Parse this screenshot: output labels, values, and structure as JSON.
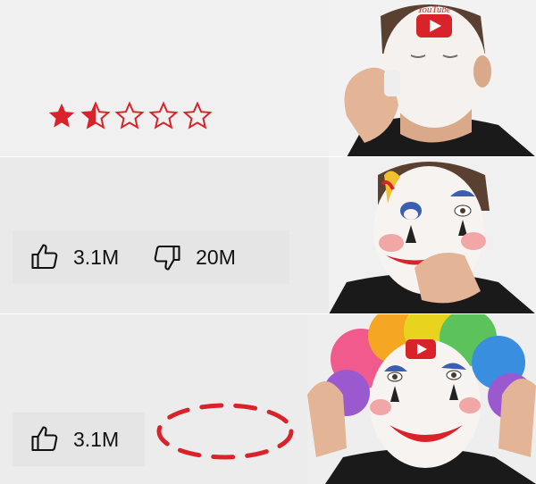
{
  "panel1": {
    "rating": 1.5,
    "max_rating": 5
  },
  "panel2": {
    "like_count": "3.1M",
    "dislike_count": "20M"
  },
  "panel3": {
    "like_count": "3.1M"
  },
  "logo_text": "YouTube",
  "colors": {
    "red": "#d8232a",
    "background": "#eeeeee",
    "bar": "#e5e5e5"
  },
  "icons": {
    "like": "thumbs-up-icon",
    "dislike": "thumbs-down-icon",
    "star": "star-icon"
  }
}
